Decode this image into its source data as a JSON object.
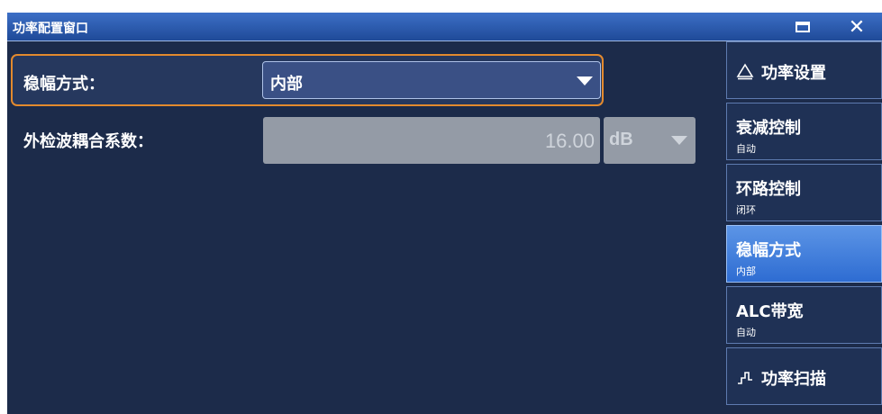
{
  "window": {
    "title": "功率配置窗口"
  },
  "form": {
    "leveling": {
      "label": "稳幅方式：",
      "value": "内部"
    },
    "coupling": {
      "label": "外检波耦合系数：",
      "value": "16.00",
      "unit": "dB"
    }
  },
  "sidebar": {
    "items": [
      {
        "label": "功率设置",
        "sub": "",
        "icon": "triangle-icon"
      },
      {
        "label": "衰减控制",
        "sub": "自动"
      },
      {
        "label": "环路控制",
        "sub": "闭环"
      },
      {
        "label": "稳幅方式",
        "sub": "内部"
      },
      {
        "label": "ALC带宽",
        "sub": "自动"
      },
      {
        "label": "功率扫描",
        "sub": "",
        "icon": "step-icon"
      }
    ]
  },
  "colors": {
    "accent": "#e38a2e",
    "active": "#3a7be0",
    "background": "#1c2b4a"
  }
}
